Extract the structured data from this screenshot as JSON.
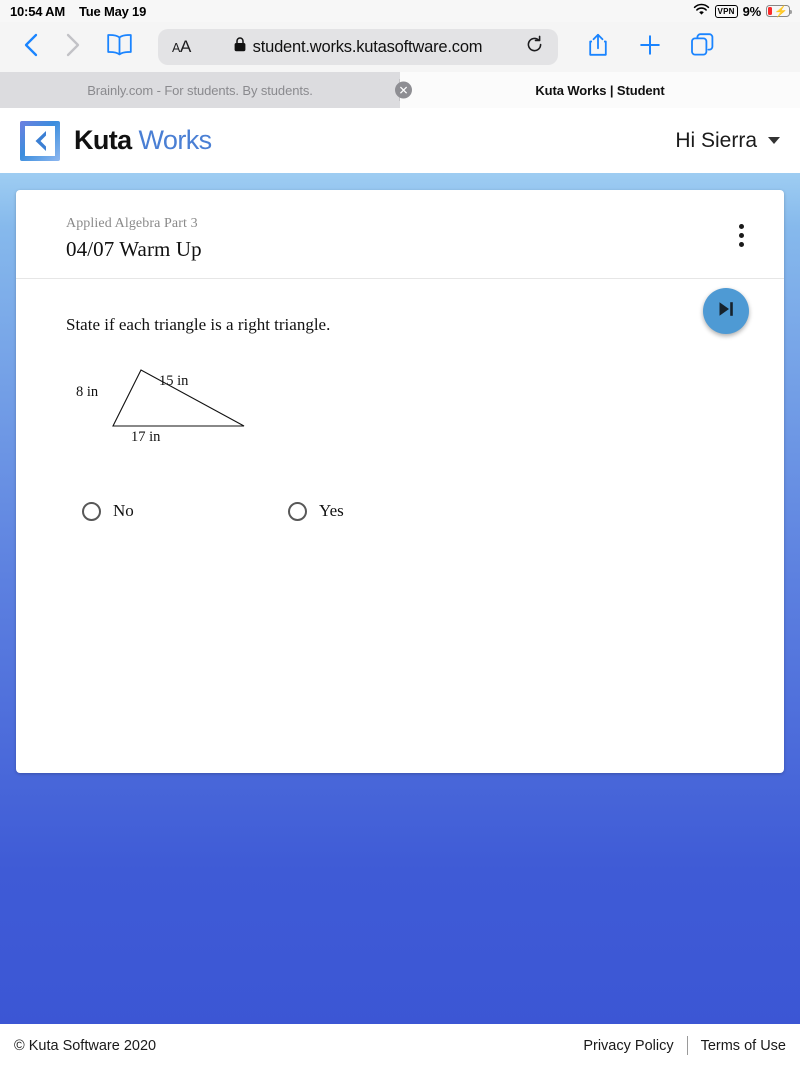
{
  "status_bar": {
    "time": "10:54 AM",
    "date": "Tue May 19",
    "wifi_icon": "wifi-icon",
    "vpn_label": "VPN",
    "battery_percent": "9%",
    "battery_icon": "battery-charging-icon"
  },
  "browser": {
    "back_icon": "chevron-left-icon",
    "forward_icon": "chevron-right-icon",
    "bookmarks_icon": "book-icon",
    "text_size_label_large": "A",
    "text_size_label_small": "A",
    "lock_icon": "lock-icon",
    "url": "student.works.kutasoftware.com",
    "reload_icon": "reload-icon",
    "share_icon": "share-icon",
    "new_tab_icon": "plus-icon",
    "tabs_icon": "tabs-icon",
    "tabs": [
      {
        "title": "Brainly.com - For students. By students.",
        "active": false,
        "close_icon": "close-icon"
      },
      {
        "title": "Kuta Works | Student",
        "active": true
      }
    ]
  },
  "site_header": {
    "logo_mark_icon": "kuta-logo-icon",
    "logo_primary": "Kuta",
    "logo_secondary": "Works",
    "user_greeting": "Hi Sierra",
    "user_menu_icon": "chevron-down-icon"
  },
  "assignment_card": {
    "course": "Applied Algebra Part 3",
    "title": "04/07 Warm Up",
    "menu_icon": "more-vertical-icon",
    "question": {
      "prompt": "State if each triangle is a right triangle.",
      "figure": {
        "type": "triangle",
        "labels": {
          "left_side": "8 in",
          "hypotenuse": "15 in",
          "base": "17 in"
        }
      },
      "choices": [
        {
          "label": "No",
          "selected": false
        },
        {
          "label": "Yes",
          "selected": false
        }
      ]
    },
    "next_button_icon": "skip-next-icon"
  },
  "footer": {
    "copyright": "© Kuta Software 2020",
    "privacy": "Privacy Policy",
    "terms": "Terms of Use"
  },
  "colors": {
    "accent_blue": "#4e9ad4",
    "safari_blue": "#1a84ff",
    "page_gradient_top": "#9ecdf2",
    "page_gradient_bottom": "#3b55d4"
  }
}
